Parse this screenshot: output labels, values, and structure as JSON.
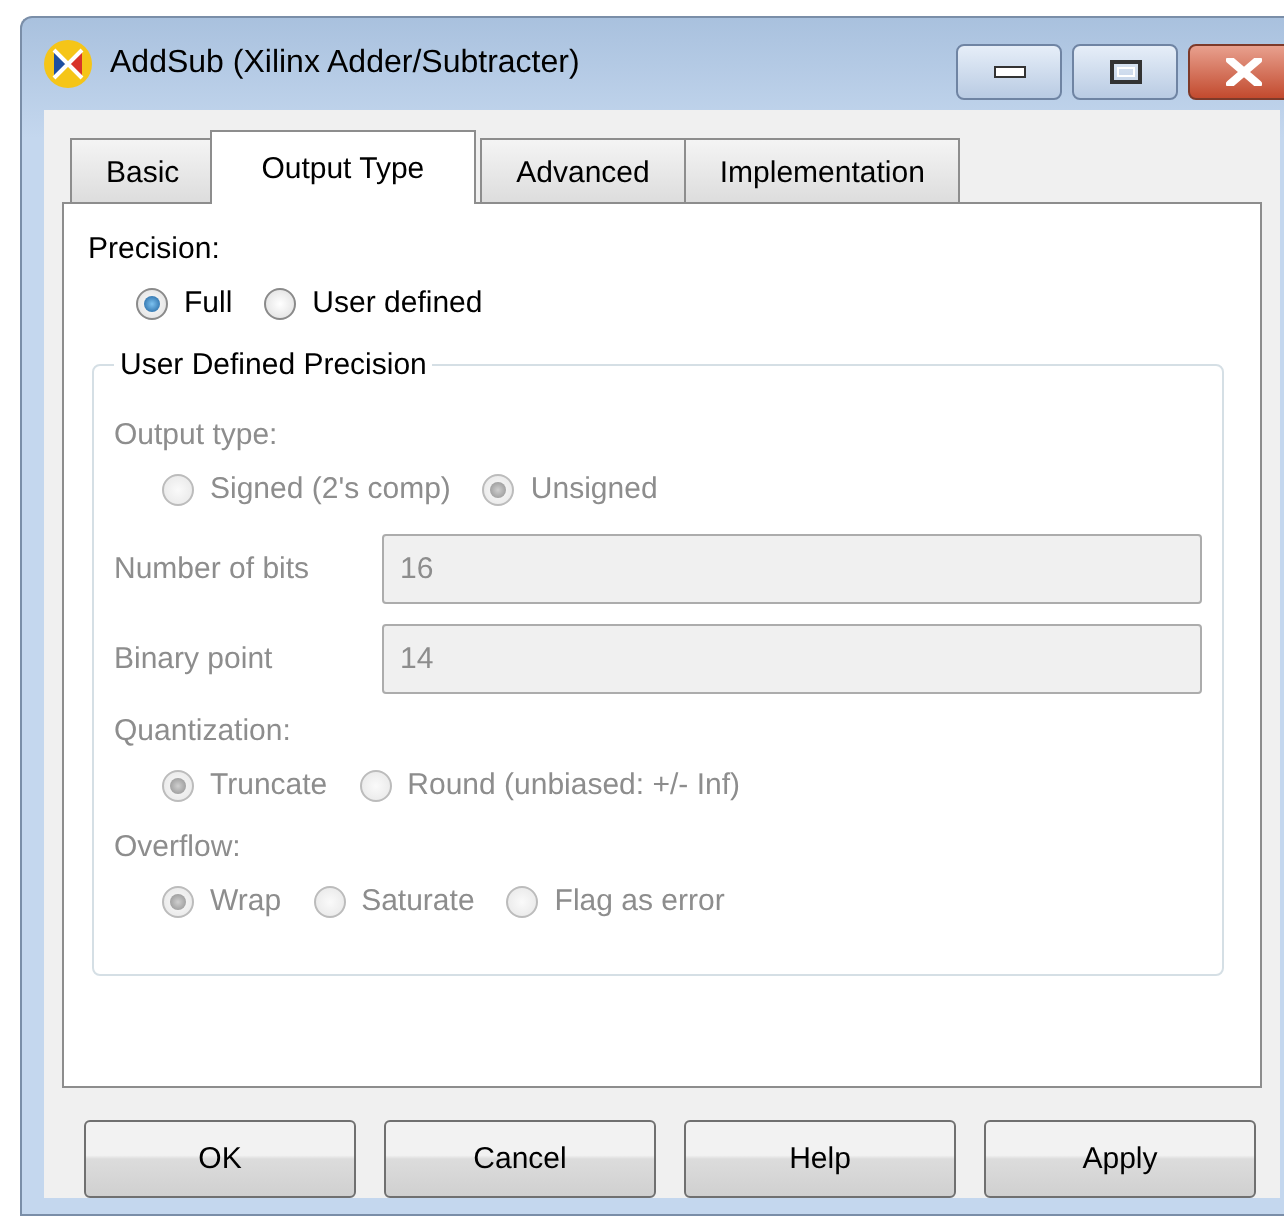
{
  "window": {
    "title": "AddSub (Xilinx Adder/Subtracter)"
  },
  "caption_buttons": [
    {
      "kind": "minimize"
    },
    {
      "kind": "maximize"
    },
    {
      "kind": "close"
    }
  ],
  "tabs": [
    {
      "label": "Basic",
      "selected": false
    },
    {
      "label": "Output Type",
      "selected": true
    },
    {
      "label": "Advanced",
      "selected": false
    },
    {
      "label": "Implementation",
      "selected": false
    }
  ],
  "precision": {
    "label": "Precision:",
    "options": [
      {
        "label": "Full",
        "selected": true
      },
      {
        "label": "User defined",
        "selected": false
      }
    ]
  },
  "group": {
    "title": "User Defined Precision",
    "disabled": true,
    "sections": [
      {
        "kind": "radios",
        "label": "Output type:",
        "options": [
          {
            "label": "Signed (2's comp)",
            "selected": false
          },
          {
            "label": "Unsigned",
            "selected": true
          }
        ]
      },
      {
        "kind": "field",
        "label": "Number of bits",
        "value": "16"
      },
      {
        "kind": "field",
        "label": "Binary point",
        "value": "14"
      },
      {
        "kind": "radios",
        "label": "Quantization:",
        "options": [
          {
            "label": "Truncate",
            "selected": true
          },
          {
            "label": "Round (unbiased: +/- Inf)",
            "selected": false
          }
        ]
      },
      {
        "kind": "radios",
        "label": "Overflow:",
        "options": [
          {
            "label": "Wrap",
            "selected": true
          },
          {
            "label": "Saturate",
            "selected": false
          },
          {
            "label": "Flag as error",
            "selected": false
          }
        ]
      }
    ]
  },
  "buttons": [
    "OK",
    "Cancel",
    "Help",
    "Apply"
  ]
}
